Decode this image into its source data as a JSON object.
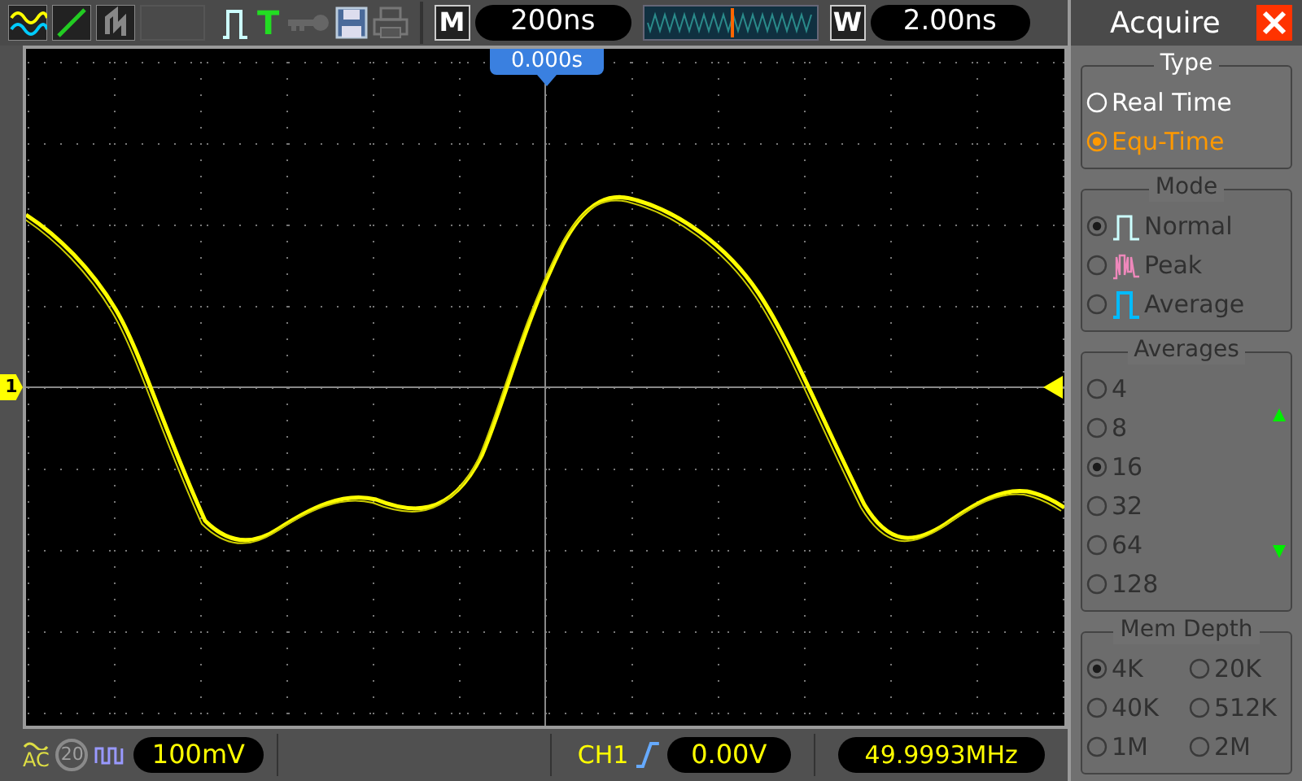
{
  "top_bar": {
    "trigger_type": "T",
    "timebase_label": "M",
    "timebase": "200ns",
    "window_label": "W",
    "window_timebase": "2.00ns"
  },
  "screen": {
    "trigger_position": "0.000s",
    "channel_marker": "1"
  },
  "panel": {
    "title": "Acquire",
    "groups": [
      {
        "title": "Type",
        "disabled": false,
        "kind": "list",
        "options": [
          {
            "label": "Real Time",
            "selected": false
          },
          {
            "label": "Equ-Time",
            "selected": true
          }
        ]
      },
      {
        "title": "Mode",
        "disabled": true,
        "kind": "list",
        "options": [
          {
            "label": "Normal",
            "selected": true,
            "kind": "normal"
          },
          {
            "label": "Peak",
            "selected": false,
            "kind": "peak"
          },
          {
            "label": "Average",
            "selected": false,
            "kind": "average"
          }
        ]
      },
      {
        "title": "Averages",
        "disabled": true,
        "kind": "scroll_list",
        "options": [
          {
            "label": "4",
            "selected": false
          },
          {
            "label": "8",
            "selected": false
          },
          {
            "label": "16",
            "selected": true
          },
          {
            "label": "32",
            "selected": false
          },
          {
            "label": "64",
            "selected": false
          },
          {
            "label": "128",
            "selected": false
          }
        ]
      },
      {
        "title": "Mem Depth",
        "disabled": true,
        "kind": "grid",
        "options": [
          {
            "label": "4K",
            "selected": true
          },
          {
            "label": "20K",
            "selected": false
          },
          {
            "label": "40K",
            "selected": false
          },
          {
            "label": "512K",
            "selected": false
          },
          {
            "label": "1M",
            "selected": false
          },
          {
            "label": "2M",
            "selected": false
          }
        ]
      }
    ]
  },
  "bottom_bar": {
    "coupling": "AC",
    "bandwidth_limit": "20",
    "volts_per_div": "100mV",
    "trigger_source": "CH1",
    "trigger_level": "0.00V",
    "frequency": "49.9993MHz"
  }
}
